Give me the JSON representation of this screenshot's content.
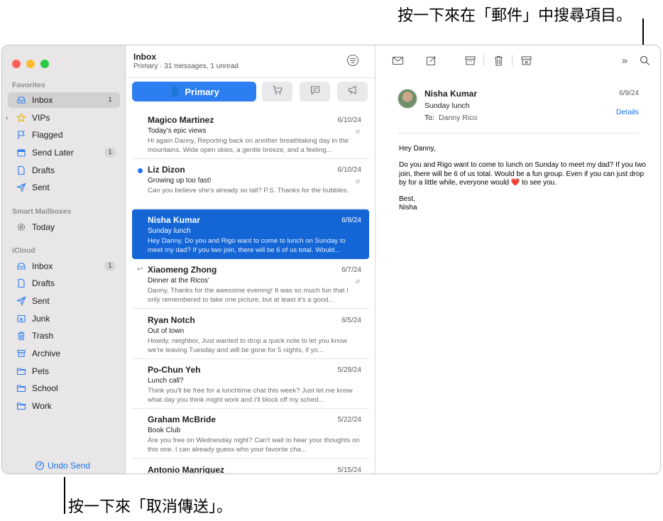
{
  "callouts": {
    "top": "按一下來在「郵件」中搜尋項目。",
    "bottom": "按一下來「取消傳送」。"
  },
  "sidebar": {
    "favorites_title": "Favorites",
    "favorites": [
      {
        "label": "Inbox",
        "icon": "inbox-icon",
        "badge": "1"
      },
      {
        "label": "VIPs",
        "icon": "star-icon",
        "badge": ""
      },
      {
        "label": "Flagged",
        "icon": "flag-icon",
        "badge": ""
      },
      {
        "label": "Send Later",
        "icon": "calendar-icon",
        "badge": "1"
      },
      {
        "label": "Drafts",
        "icon": "document-icon",
        "badge": ""
      },
      {
        "label": "Sent",
        "icon": "paperplane-icon",
        "badge": ""
      }
    ],
    "smart_title": "Smart Mailboxes",
    "smart": [
      {
        "label": "Today",
        "icon": "gear-icon"
      }
    ],
    "icloud_title": "iCloud",
    "icloud": [
      {
        "label": "Inbox",
        "icon": "inbox-icon",
        "badge": "1"
      },
      {
        "label": "Drafts",
        "icon": "document-icon",
        "badge": ""
      },
      {
        "label": "Sent",
        "icon": "paperplane-icon",
        "badge": ""
      },
      {
        "label": "Junk",
        "icon": "junk-icon",
        "badge": ""
      },
      {
        "label": "Trash",
        "icon": "trash-icon",
        "badge": ""
      },
      {
        "label": "Archive",
        "icon": "archive-icon",
        "badge": ""
      },
      {
        "label": "Pets",
        "icon": "folder-icon",
        "badge": ""
      },
      {
        "label": "School",
        "icon": "folder-icon",
        "badge": ""
      },
      {
        "label": "Work",
        "icon": "folder-icon",
        "badge": ""
      }
    ],
    "undo_send": "Undo Send"
  },
  "list": {
    "title": "Inbox",
    "subtitle": "Primary · 31 messages, 1 unread",
    "primary_tab": "Primary",
    "messages": [
      {
        "sender": "Magico Martinez",
        "date": "6/10/24",
        "subject": "Today's epic views",
        "preview": "Hi again Danny, Reporting back on another breathtaking day in the mountains. Wide open skies, a gentle breeze, and a feeling..."
      },
      {
        "sender": "Liz Dizon",
        "date": "6/10/24",
        "subject": "Growing up too fast!",
        "preview": "Can you believe she's already so tall? P.S. Thanks for the bubbles."
      },
      {
        "sender": "Nisha Kumar",
        "date": "6/9/24",
        "subject": "Sunday lunch",
        "preview": "Hey Danny, Do you and Rigo want to come to lunch on Sunday to meet my dad? If you two join, there will be 6 of us total. Would..."
      },
      {
        "sender": "Xiaomeng Zhong",
        "date": "6/7/24",
        "subject": "Dinner at the Ricos'",
        "preview": "Danny, Thanks for the awesome evening! It was so much fun that I only remembered to take one picture, but at least it's a good..."
      },
      {
        "sender": "Ryan Notch",
        "date": "6/5/24",
        "subject": "Out of town",
        "preview": "Howdy, neighbor, Just wanted to drop a quick note to let you know we're leaving Tuesday and will be gone for 5 nights, if yo..."
      },
      {
        "sender": "Po-Chun Yeh",
        "date": "5/29/24",
        "subject": "Lunch call?",
        "preview": "Think you'll be free for a lunchtime chat this week? Just let me know what day you think might work and I'll block off my sched..."
      },
      {
        "sender": "Graham McBride",
        "date": "5/22/24",
        "subject": "Book Club",
        "preview": "Are you free on Wednesday night? Can't wait to hear your thoughts on this one. I can already guess who your favorite cha..."
      },
      {
        "sender": "Antonio Manriquez",
        "date": "5/15/24",
        "subject": "",
        "preview": ""
      }
    ]
  },
  "reader": {
    "sender": "Nisha Kumar",
    "subject": "Sunday lunch",
    "to_label": "To:",
    "to_value": "Danny Rico",
    "date": "6/9/24",
    "details": "Details",
    "greeting": "Hey Danny,",
    "paragraph_before_heart": "Do you and Rigo want to come to lunch on Sunday to meet my dad? If you two join, there will be 6 of us total. Would be a fun group. Even if you can just drop by for a little while, everyone would",
    "heart": "❤️",
    "paragraph_after_heart": "to see you.",
    "signoff": "Best,",
    "signature": "Nisha"
  }
}
